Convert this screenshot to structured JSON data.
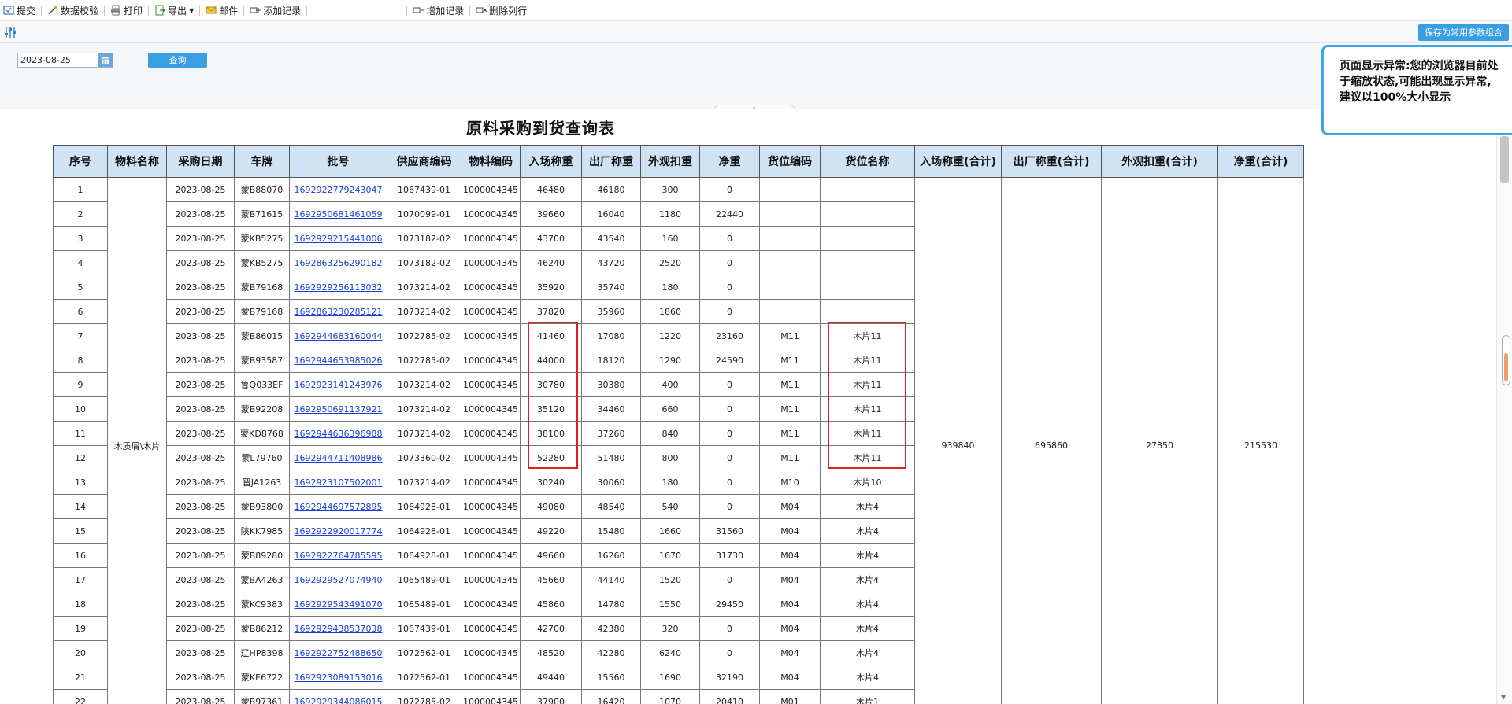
{
  "toolbar": {
    "submit": "提交",
    "validate": "数据校验",
    "print": "打印",
    "export": "导出",
    "mail": "邮件",
    "add_record": "添加记录",
    "insert_record": "增加记录",
    "delete_row": "删除列行"
  },
  "secondbar": {
    "save_combo": "保存为常用参数组合"
  },
  "params": {
    "date_value": "2023-08-25",
    "query_button": "查询"
  },
  "warning": {
    "text": "页面显示异常:您的浏览器目前处于缩放状态,可能出现显示异常,建议以100%大小显示"
  },
  "report": {
    "title": "原料采购到货查询表",
    "columns": [
      "序号",
      "物料名称",
      "采购日期",
      "车牌",
      "批号",
      "供应商编码",
      "物料编码",
      "入场称重",
      "出厂称重",
      "外观扣重",
      "净重",
      "货位编码",
      "货位名称",
      "入场称重(合计)",
      "出厂称重(合计)",
      "外观扣重(合计)",
      "净重(合计)"
    ],
    "material_name": "木质屑\\木片",
    "totals": {
      "in_weight": "939840",
      "out_weight": "695860",
      "deduct": "27850",
      "net": "215530"
    },
    "rows": [
      [
        "1",
        "2023-08-25",
        "蒙B88070",
        "1692922779243047",
        "1067439-01",
        "1000004345",
        "46480",
        "46180",
        "300",
        "0",
        "",
        ""
      ],
      [
        "2",
        "2023-08-25",
        "蒙B71615",
        "1692950681461059",
        "1070099-01",
        "1000004345",
        "39660",
        "16040",
        "1180",
        "22440",
        "",
        ""
      ],
      [
        "3",
        "2023-08-25",
        "蒙KB5275",
        "1692929215441006",
        "1073182-02",
        "1000004345",
        "43700",
        "43540",
        "160",
        "0",
        "",
        ""
      ],
      [
        "4",
        "2023-08-25",
        "蒙KB5275",
        "1692863256290182",
        "1073182-02",
        "1000004345",
        "46240",
        "43720",
        "2520",
        "0",
        "",
        ""
      ],
      [
        "5",
        "2023-08-25",
        "蒙B79168",
        "1692929256113032",
        "1073214-02",
        "1000004345",
        "35920",
        "35740",
        "180",
        "0",
        "",
        ""
      ],
      [
        "6",
        "2023-08-25",
        "蒙B79168",
        "1692863230285121",
        "1073214-02",
        "1000004345",
        "37820",
        "35960",
        "1860",
        "0",
        "",
        ""
      ],
      [
        "7",
        "2023-08-25",
        "蒙B86015",
        "1692944683160044",
        "1072785-02",
        "1000004345",
        "41460",
        "17080",
        "1220",
        "23160",
        "M11",
        "木片11"
      ],
      [
        "8",
        "2023-08-25",
        "蒙B93587",
        "1692944653985026",
        "1072785-02",
        "1000004345",
        "44000",
        "18120",
        "1290",
        "24590",
        "M11",
        "木片11"
      ],
      [
        "9",
        "2023-08-25",
        "鲁Q033EF",
        "1692923141243976",
        "1073214-02",
        "1000004345",
        "30780",
        "30380",
        "400",
        "0",
        "M11",
        "木片11"
      ],
      [
        "10",
        "2023-08-25",
        "蒙B92208",
        "1692950691137921",
        "1073214-02",
        "1000004345",
        "35120",
        "34460",
        "660",
        "0",
        "M11",
        "木片11"
      ],
      [
        "11",
        "2023-08-25",
        "蒙KD8768",
        "1692944636396988",
        "1073214-02",
        "1000004345",
        "38100",
        "37260",
        "840",
        "0",
        "M11",
        "木片11"
      ],
      [
        "12",
        "2023-08-25",
        "蒙L79760",
        "1692944711408986",
        "1073360-02",
        "1000004345",
        "52280",
        "51480",
        "800",
        "0",
        "M11",
        "木片11"
      ],
      [
        "13",
        "2023-08-25",
        "晋JA1263",
        "1692923107502001",
        "1073214-02",
        "1000004345",
        "30240",
        "30060",
        "180",
        "0",
        "M10",
        "木片10"
      ],
      [
        "14",
        "2023-08-25",
        "蒙B93800",
        "1692944697572895",
        "1064928-01",
        "1000004345",
        "49080",
        "48540",
        "540",
        "0",
        "M04",
        "木片4"
      ],
      [
        "15",
        "2023-08-25",
        "陕KK7985",
        "1692922920017774",
        "1064928-01",
        "1000004345",
        "49220",
        "15480",
        "1660",
        "31560",
        "M04",
        "木片4"
      ],
      [
        "16",
        "2023-08-25",
        "蒙B89280",
        "1692922764785595",
        "1064928-01",
        "1000004345",
        "49660",
        "16260",
        "1670",
        "31730",
        "M04",
        "木片4"
      ],
      [
        "17",
        "2023-08-25",
        "蒙BA4263",
        "1692929527074940",
        "1065489-01",
        "1000004345",
        "45660",
        "44140",
        "1520",
        "0",
        "M04",
        "木片4"
      ],
      [
        "18",
        "2023-08-25",
        "蒙KC9383",
        "1692929543491070",
        "1065489-01",
        "1000004345",
        "45860",
        "14780",
        "1550",
        "29450",
        "M04",
        "木片4"
      ],
      [
        "19",
        "2023-08-25",
        "蒙B86212",
        "1692929438537038",
        "1067439-01",
        "1000004345",
        "42700",
        "42380",
        "320",
        "0",
        "M04",
        "木片4"
      ],
      [
        "20",
        "2023-08-25",
        "辽HP8398",
        "1692922752488650",
        "1072562-01",
        "1000004345",
        "48520",
        "42280",
        "6240",
        "0",
        "M04",
        "木片4"
      ],
      [
        "21",
        "2023-08-25",
        "蒙KE6722",
        "1692923089153016",
        "1072562-01",
        "1000004345",
        "49440",
        "15560",
        "1690",
        "32190",
        "M04",
        "木片4"
      ],
      [
        "22",
        "2023-08-25",
        "蒙B97361",
        "1692929344086015",
        "1072785-02",
        "1000004345",
        "37900",
        "16420",
        "1070",
        "20410",
        "M01",
        "木片1"
      ]
    ]
  },
  "colors": {
    "header_bg": "#cfe3f5",
    "highlight": "#e02020",
    "link": "#1a3fd6",
    "button": "#3a9ee3"
  }
}
